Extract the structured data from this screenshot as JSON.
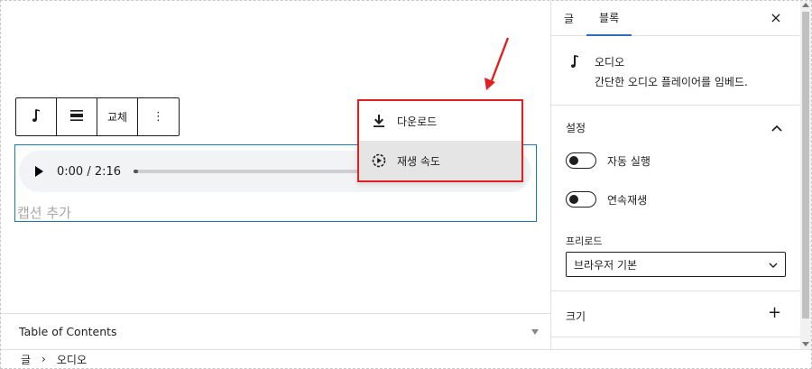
{
  "toolbar": {
    "replace_label": "교체",
    "more_label": "⋮"
  },
  "audio": {
    "time": "0:00 / 2:16",
    "progress": 0.02,
    "caption_placeholder": "캡션 추가"
  },
  "menu": {
    "items": [
      {
        "label": "다운로드",
        "icon": "download-icon"
      },
      {
        "label": "재생 속도",
        "icon": "playback-speed-icon"
      }
    ]
  },
  "toc": {
    "title": "Table of Contents"
  },
  "breadcrumb": {
    "items": [
      "글",
      "오디오"
    ],
    "separator": "›"
  },
  "sidebar": {
    "tabs": [
      {
        "label": "글",
        "active": false
      },
      {
        "label": "블록",
        "active": true
      }
    ],
    "close_label": "×",
    "block": {
      "name": "오디오",
      "description": "간단한 오디오 플레이어를 임베드."
    },
    "settings": {
      "title": "설정",
      "autoplay_label": "자동 실행",
      "loop_label": "연속재생",
      "preload_label": "프리로드",
      "preload_value": "브라우저 기본"
    },
    "size": {
      "title": "크기"
    }
  },
  "colors": {
    "accent": "#2a6fb8",
    "annotation": "#e02020",
    "block_border": "#1b7bb0"
  }
}
